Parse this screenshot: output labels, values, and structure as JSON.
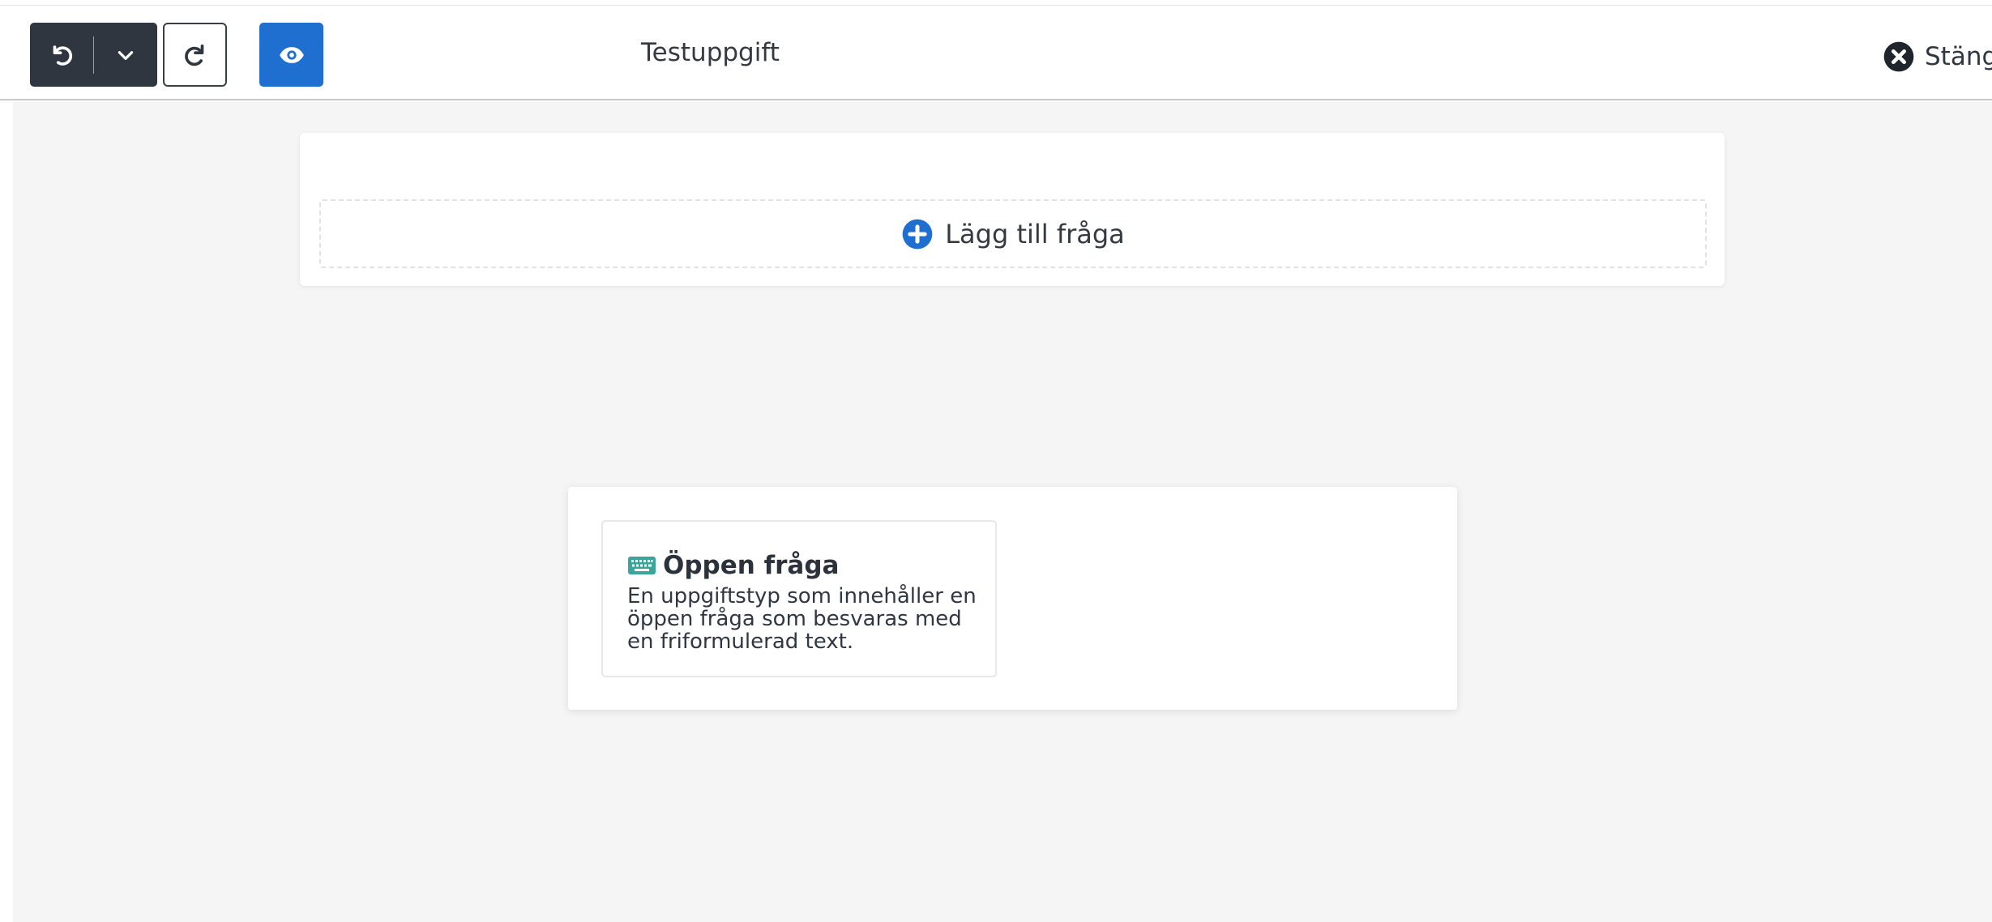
{
  "toolbar": {
    "undo_icon": "undo-icon",
    "undo_menu_icon": "chevron-down-icon",
    "redo_icon": "redo-icon",
    "preview_icon": "eye-icon",
    "title": "Testuppgift",
    "close_icon": "close-circle-icon",
    "close_label": "Stäng"
  },
  "editor": {
    "add_question_icon": "plus-circle-icon",
    "add_question_label": "Lägg till fråga"
  },
  "question_types": [
    {
      "icon": "keyboard-icon",
      "title": "Öppen fråga",
      "description": "En uppgiftstyp som innehåller en öppen fråga som besvaras med en friformulerad text."
    }
  ],
  "colors": {
    "toolbar_dark": "#2f3640",
    "accent_blue": "#1f6fd1",
    "keyboard_teal": "#3aa59a",
    "canvas_bg": "#f5f5f5"
  }
}
